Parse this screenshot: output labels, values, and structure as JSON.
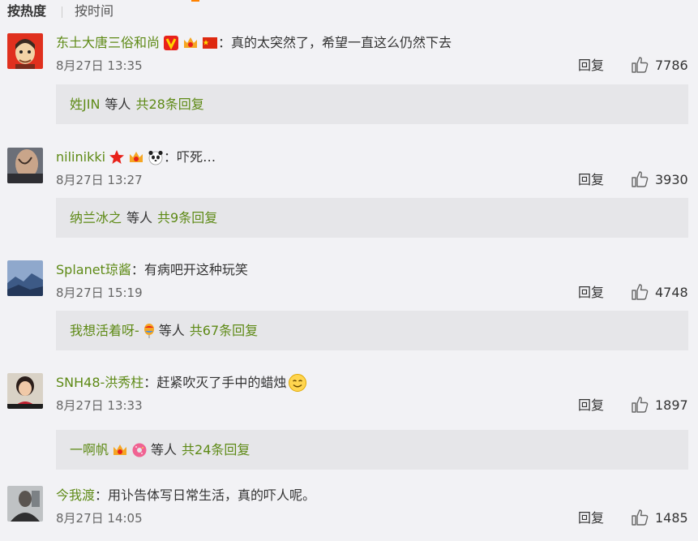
{
  "tabs": [
    {
      "label": "按热度",
      "active": true
    },
    {
      "label": "按时间",
      "active": false
    }
  ],
  "reply_label": "回复",
  "colon": "：",
  "comments": [
    {
      "username": "东土大唐三俗和尚",
      "badges": [
        "v-badge-icon",
        "crown-badge-icon",
        "china-flag-icon"
      ],
      "text": "真的太突然了，希望一直这么仍然下去",
      "time": "8月27日 13:35",
      "likes": "7786",
      "replies": {
        "names": "姓JIN",
        "middle": "等人",
        "count": "共28条回复",
        "badges": []
      }
    },
    {
      "username": "nilinikki",
      "badges": [
        "star-badge-icon",
        "crown-badge-icon",
        "panda-icon"
      ],
      "text": "吓死…",
      "time": "8月27日 13:27",
      "likes": "3930",
      "replies": {
        "names": "纳兰冰之",
        "middle": "等人",
        "count": "共9条回复",
        "badges": []
      }
    },
    {
      "username": "Splanet琼酱",
      "badges": [],
      "text": "有病吧开这种玩笑",
      "time": "8月27日 15:19",
      "likes": "4748",
      "replies": {
        "names": "我想活着呀-",
        "middle": "等人",
        "count": "共67条回复",
        "badges": [
          "balloon-icon"
        ]
      }
    },
    {
      "username": "SNH48-洪秀柱",
      "badges": [],
      "text": "赶紧吹灭了手中的蜡烛",
      "text_emoji": "smile-emoji-icon",
      "time": "8月27日 13:33",
      "likes": "1897",
      "replies": {
        "names": "一啊帆",
        "middle": "等人",
        "count": "共24条回复",
        "badges": [
          "crown-badge-icon",
          "donut-icon"
        ]
      }
    },
    {
      "username": "今我渡",
      "badges": [],
      "text": "用讣告体写日常生活，真的吓人呢。",
      "time": "8月27日 14:05",
      "likes": "1485"
    }
  ]
}
